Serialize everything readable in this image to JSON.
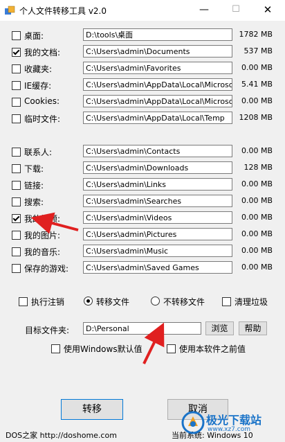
{
  "window": {
    "title": "个人文件转移工具 v2.0"
  },
  "folders": [
    {
      "label": "桌面:",
      "path": "D:\\tools\\桌面",
      "size": "1782 MB",
      "checked": false
    },
    {
      "label": "我的文档:",
      "path": "C:\\Users\\admin\\Documents",
      "size": "537 MB",
      "checked": true
    },
    {
      "label": "收藏夹:",
      "path": "C:\\Users\\admin\\Favorites",
      "size": "0.00 MB",
      "checked": false
    },
    {
      "label": "IE缓存:",
      "path": "C:\\Users\\admin\\AppData\\Local\\Microsoft\\W",
      "size": "5.41 MB",
      "checked": false
    },
    {
      "label": "Cookies:",
      "path": "C:\\Users\\admin\\AppData\\Local\\Microsoft\\W",
      "size": "0.00 MB",
      "checked": false
    },
    {
      "label": "临时文件:",
      "path": "C:\\Users\\admin\\AppData\\Local\\Temp",
      "size": "1208 MB",
      "checked": false
    },
    {
      "label": "联系人:",
      "path": "C:\\Users\\admin\\Contacts",
      "size": "0.00 MB",
      "checked": false
    },
    {
      "label": "下载:",
      "path": "C:\\Users\\admin\\Downloads",
      "size": "128 MB",
      "checked": false
    },
    {
      "label": "链接:",
      "path": "C:\\Users\\admin\\Links",
      "size": "0.00 MB",
      "checked": false
    },
    {
      "label": "搜索:",
      "path": "C:\\Users\\admin\\Searches",
      "size": "0.00 MB",
      "checked": false
    },
    {
      "label": "我的视频:",
      "path": "C:\\Users\\admin\\Videos",
      "size": "0.00 MB",
      "checked": true
    },
    {
      "label": "我的图片:",
      "path": "C:\\Users\\admin\\Pictures",
      "size": "0.00 MB",
      "checked": false
    },
    {
      "label": "我的音乐:",
      "path": "C:\\Users\\admin\\Music",
      "size": "0.00 MB",
      "checked": false
    },
    {
      "label": "保存的游戏:",
      "path": "C:\\Users\\admin\\Saved Games",
      "size": "0.00 MB",
      "checked": false
    }
  ],
  "options": {
    "logout": "执行注销",
    "transfer": "转移文件",
    "no_transfer": "不转移文件",
    "clean": "清理垃圾",
    "selected_mode": "transfer"
  },
  "target": {
    "label": "目标文件夹:",
    "value": "D:\\Personal",
    "browse": "浏览",
    "help": "帮助",
    "use_windows_default": "使用Windows默认值",
    "use_previous": "使用本软件之前值"
  },
  "actions": {
    "go": "转移",
    "cancel": "取消"
  },
  "footer": {
    "left": "DOS之家 http://doshome.com",
    "right": "当前系统: Windows 10"
  },
  "watermark": {
    "cn": "极光下载站",
    "en": "www.xz7.com"
  },
  "colors": {
    "accent_arrow": "#e02020",
    "button_focus": "#0078d7",
    "watermark": "#1a73c8"
  }
}
